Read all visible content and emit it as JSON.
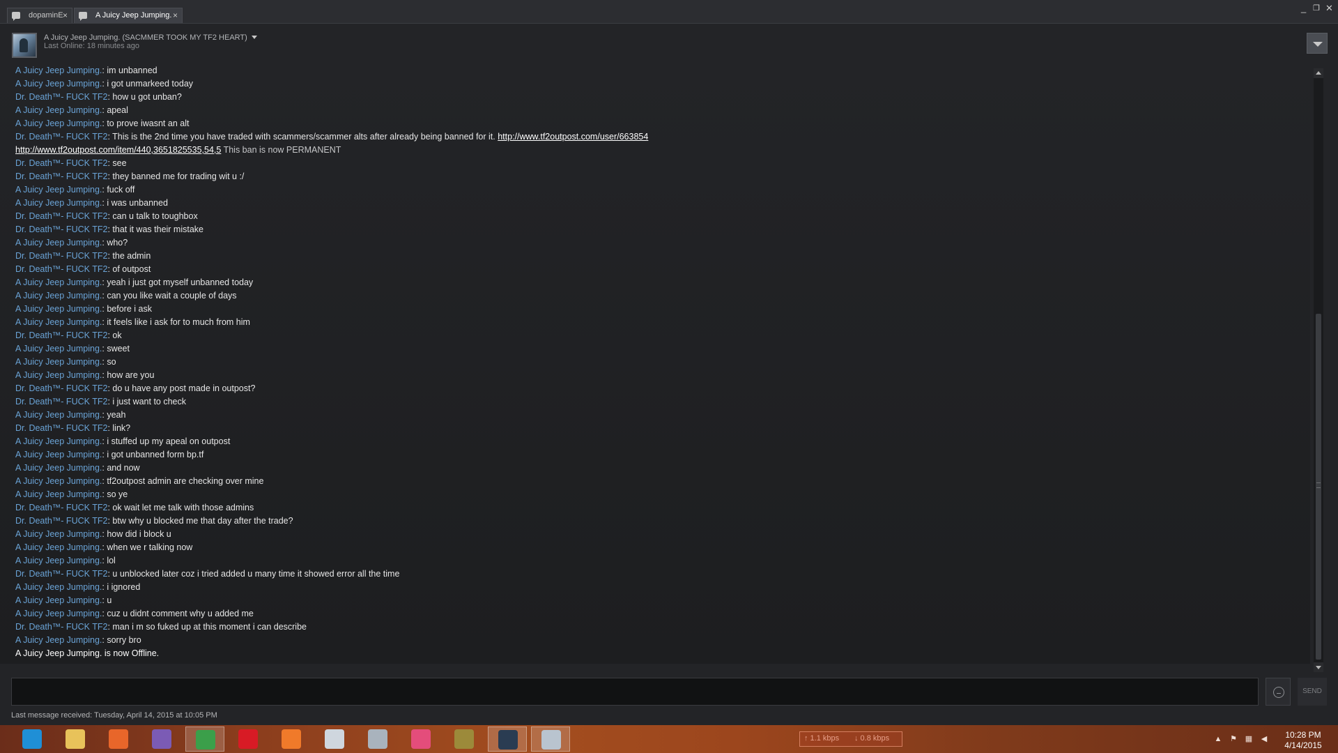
{
  "tabs": [
    {
      "label": "dopaminE",
      "close": "×"
    },
    {
      "label": "A Juicy Jeep Jumping.",
      "close": "×"
    }
  ],
  "window_controls": {
    "minimize": "_",
    "restore": "❐",
    "close": "✕"
  },
  "header": {
    "friend_name": "A Juicy Jeep Jumping. (SACMMER TOOK MY TF2 HEART)",
    "last_online": "Last Online: 18 minutes ago"
  },
  "messages": [
    {
      "sender": "A Juicy Jeep Jumping.",
      "text": "im unbanned"
    },
    {
      "sender": "A Juicy Jeep Jumping.",
      "text": "i got unmarkeed today"
    },
    {
      "sender": "Dr. Death™- FUCK TF2",
      "text": "how u got unban?"
    },
    {
      "sender": "A Juicy Jeep Jumping.",
      "text": "apeal"
    },
    {
      "sender": "A Juicy Jeep Jumping.",
      "text": "to prove iwasnt an alt"
    },
    {
      "sender": "Dr. Death™- FUCK TF2",
      "text": "This is the 2nd time you have traded with scammers/scammer alts after already being banned for it.",
      "link": "http://www.tf2outpost.com/user/663854"
    },
    {
      "continuation": true,
      "link": "http://www.tf2outpost.com/item/440,3651825535,54,5",
      "text": "This ban is now PERMANENT"
    },
    {
      "sender": "Dr. Death™- FUCK TF2",
      "text": "see"
    },
    {
      "sender": "Dr. Death™- FUCK TF2",
      "text": "they banned me for trading wit u :/"
    },
    {
      "sender": "A Juicy Jeep Jumping.",
      "text": "fuck off"
    },
    {
      "sender": "A Juicy Jeep Jumping.",
      "text": "i was unbanned"
    },
    {
      "sender": "Dr. Death™- FUCK TF2",
      "text": "can u talk to toughbox"
    },
    {
      "sender": "Dr. Death™- FUCK TF2",
      "text": "that it was their mistake"
    },
    {
      "sender": "A Juicy Jeep Jumping.",
      "text": "who?"
    },
    {
      "sender": "Dr. Death™- FUCK TF2",
      "text": "the admin"
    },
    {
      "sender": "Dr. Death™- FUCK TF2",
      "text": "of outpost"
    },
    {
      "sender": "A Juicy Jeep Jumping.",
      "text": "yeah i just got myself unbanned today"
    },
    {
      "sender": "A Juicy Jeep Jumping.",
      "text": "can you like wait a couple of days"
    },
    {
      "sender": "A Juicy Jeep Jumping.",
      "text": "before i ask"
    },
    {
      "sender": "A Juicy Jeep Jumping.",
      "text": "it feels like i ask for to much from him"
    },
    {
      "sender": "Dr. Death™- FUCK TF2",
      "text": "ok"
    },
    {
      "sender": "A Juicy Jeep Jumping.",
      "text": "sweet"
    },
    {
      "sender": "A Juicy Jeep Jumping.",
      "text": "so"
    },
    {
      "sender": "A Juicy Jeep Jumping.",
      "text": "how are you"
    },
    {
      "sender": "Dr. Death™- FUCK TF2",
      "text": "do u have any post made in outpost?"
    },
    {
      "sender": "Dr. Death™- FUCK TF2",
      "text": "i just want to check"
    },
    {
      "sender": "A Juicy Jeep Jumping.",
      "text": "yeah"
    },
    {
      "sender": "Dr. Death™- FUCK TF2",
      "text": "link?"
    },
    {
      "sender": "A Juicy Jeep Jumping.",
      "text": "i stuffed up my apeal on outpost"
    },
    {
      "sender": "A Juicy Jeep Jumping.",
      "text": "i got unbanned form bp.tf"
    },
    {
      "sender": "A Juicy Jeep Jumping.",
      "text": "and now"
    },
    {
      "sender": "A Juicy Jeep Jumping.",
      "text": "tf2outpost admin are checking over mine"
    },
    {
      "sender": "A Juicy Jeep Jumping.",
      "text": "so ye"
    },
    {
      "sender": "Dr. Death™- FUCK TF2",
      "text": "ok wait let me talk with those admins"
    },
    {
      "sender": "Dr. Death™- FUCK TF2",
      "text": "btw why u blocked me that day after the trade?"
    },
    {
      "sender": "A Juicy Jeep Jumping.",
      "text": "how did i block u"
    },
    {
      "sender": "A Juicy Jeep Jumping.",
      "text": "when we r talking now"
    },
    {
      "sender": "A Juicy Jeep Jumping.",
      "text": "lol"
    },
    {
      "sender": "Dr. Death™- FUCK TF2",
      "text": "u unblocked later coz i tried added u many time it showed error all the time"
    },
    {
      "sender": "A Juicy Jeep Jumping.",
      "text": "i ignored"
    },
    {
      "sender": "A Juicy Jeep Jumping.",
      "text": "u"
    },
    {
      "sender": "A Juicy Jeep Jumping.",
      "text": "cuz u didnt comment why u added me"
    },
    {
      "sender": "Dr. Death™- FUCK TF2",
      "text": "man i m so fuked up at this moment i can describe"
    },
    {
      "sender": "A Juicy Jeep Jumping.",
      "text": "sorry bro"
    },
    {
      "status": true,
      "text": "A Juicy Jeep Jumping. is now Offline."
    }
  ],
  "input": {
    "placeholder": "",
    "value": ""
  },
  "send_label": "SEND",
  "last_received": "Last message received: Tuesday, April 14, 2015 at 10:05 PM",
  "taskbar": {
    "apps": [
      {
        "name": "internet-explorer-icon",
        "color": "#1f8fd6"
      },
      {
        "name": "file-explorer-icon",
        "color": "#e8c25a"
      },
      {
        "name": "firefox-icon",
        "color": "#e8662a"
      },
      {
        "name": "visual-studio-icon",
        "color": "#7b5bb5"
      },
      {
        "name": "chrome-icon",
        "color": "#3b9f4a"
      },
      {
        "name": "opera-icon",
        "color": "#d81b25"
      },
      {
        "name": "media-player-icon",
        "color": "#f07a2a"
      },
      {
        "name": "calculator-icon",
        "color": "#cfd6de"
      },
      {
        "name": "scanner-icon",
        "color": "#a9b3bd"
      },
      {
        "name": "photos-icon",
        "color": "#e44d7b"
      },
      {
        "name": "globe-app-icon",
        "color": "#9c8a3a"
      },
      {
        "name": "steam-icon",
        "color": "#2a3c52"
      },
      {
        "name": "paint-icon",
        "color": "#b9c4cf"
      }
    ],
    "net_up": "↑ 1.1 kbps",
    "net_down": "↓ 0.8 kbps",
    "time": "10:28 PM",
    "date": "4/14/2015"
  },
  "colors": {
    "sender": "#6aa3d6",
    "text": "#e6e6e6",
    "background": "#232427"
  }
}
